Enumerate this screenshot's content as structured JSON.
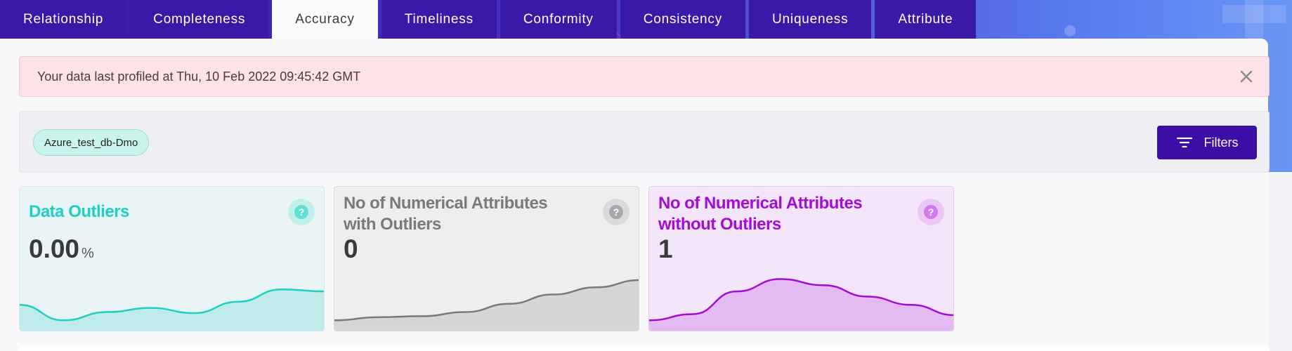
{
  "tabs": [
    {
      "label": "Relationship",
      "active": false
    },
    {
      "label": "Completeness",
      "active": false
    },
    {
      "label": "Accuracy",
      "active": true
    },
    {
      "label": "Timeliness",
      "active": false
    },
    {
      "label": "Conformity",
      "active": false
    },
    {
      "label": "Consistency",
      "active": false
    },
    {
      "label": "Uniqueness",
      "active": false
    },
    {
      "label": "Attribute",
      "active": false
    }
  ],
  "alert": {
    "message": "Your data last profiled at Thu, 10 Feb 2022 09:45:42 GMT",
    "close_icon": "close-icon"
  },
  "filter_bar": {
    "chip_label": "Azure_test_db-Dmo",
    "filters_label": "Filters",
    "filters_icon": "filter-icon"
  },
  "cards": [
    {
      "title": "Data Outliers",
      "value": "0.00",
      "unit": "%",
      "help_icon": "help-icon",
      "accent": "#1ecfc2",
      "sparkline": [
        0.25,
        0.1,
        0.18,
        0.22,
        0.17,
        0.28,
        0.4,
        0.38
      ]
    },
    {
      "title": "No of Numerical Attributes with Outliers",
      "value": "0",
      "unit": "",
      "help_icon": "help-icon",
      "accent": "#7a7a7a",
      "sparkline": [
        0.1,
        0.13,
        0.14,
        0.18,
        0.26,
        0.35,
        0.42,
        0.49
      ]
    },
    {
      "title": "No of Numerical Attributes without Outliers",
      "value": "1",
      "unit": "",
      "help_icon": "help-icon",
      "accent": "#a30bd9",
      "sparkline": [
        0.1,
        0.16,
        0.38,
        0.5,
        0.44,
        0.33,
        0.25,
        0.15
      ]
    }
  ]
}
